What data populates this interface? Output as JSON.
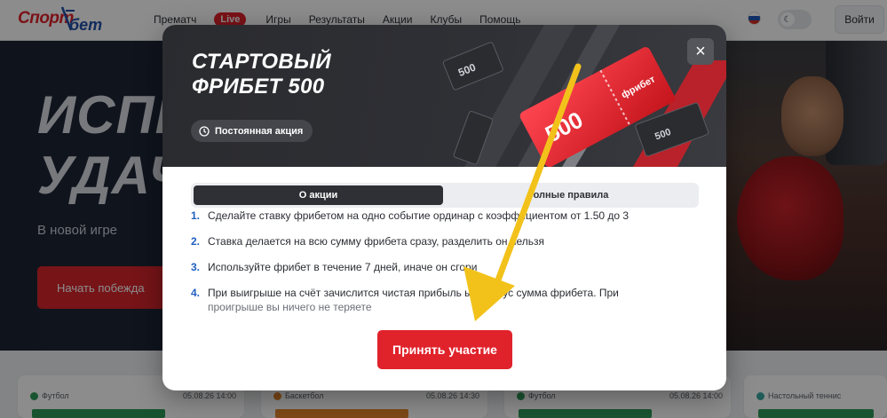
{
  "header": {
    "logo_text": "Спорт бет",
    "nav": [
      "Прематч",
      "Live",
      "Игры",
      "Результаты",
      "Акции",
      "Клубы",
      "Помощь"
    ],
    "login_label": "Войти"
  },
  "hero": {
    "title_line1": "ИСПЫ",
    "title_line2": "УДАЧ",
    "subtitle": "В новой игре",
    "button_label": "Начать побежда"
  },
  "cards": [
    {
      "sport": "Футбол",
      "date": "05.08.26 14:00",
      "color": "#2f9a59"
    },
    {
      "sport": "Баскетбол",
      "date": "05.08.26 14:30",
      "color": "#e5862b"
    },
    {
      "sport": "Футбол",
      "date": "05.08.26 14:00",
      "color": "#2f9a59"
    },
    {
      "sport": "Настольный теннис",
      "date": "",
      "color": "#2f9a59"
    }
  ],
  "modal": {
    "title": "СТАРТОВЫЙ ФРИБЕТ 500",
    "pill_label": "Постоянная акция",
    "close_glyph": "×",
    "tabs": [
      "О акции",
      "олные правила"
    ],
    "rules": [
      {
        "num": "1.",
        "text": "Сделайте ставку фрибетом на одно событие ординар с коэффициентом от 1.50 до 3"
      },
      {
        "num": "2.",
        "text": "Ставка делается на всю сумму фрибета сразу, разделить  он нельзя"
      },
      {
        "num": "3.",
        "text": "Используйте фрибет в течение 7 дней, иначе он сгори"
      },
      {
        "num": "4.",
        "text": "При выигрыше на счёт зачислится чистая прибыль          ыш минус сумма фрибета. При",
        "tail": "проигрыше вы ничего не теряете"
      }
    ],
    "accept_label": "Принять участие",
    "ticket_main": "500",
    "ticket_side": "фрибет"
  },
  "colors": {
    "brand_red": "#e0222b",
    "accent_blue": "#1f5fbf",
    "annotation_yellow": "#f2c21b"
  }
}
